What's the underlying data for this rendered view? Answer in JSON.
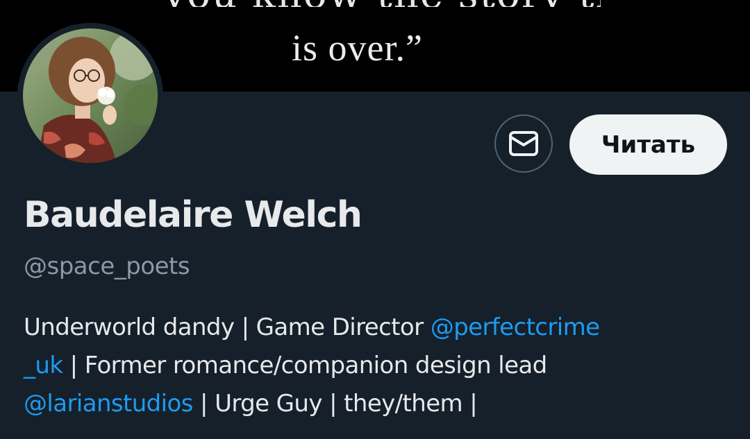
{
  "banner": {
    "quote_top": "“you know the story that",
    "quote_visible": "is over.”"
  },
  "profile": {
    "display_name": "Baudelaire Welch",
    "handle": "@space_poets",
    "follow_label": "Читать",
    "bio": {
      "line1_text": "Underworld dandy  | Game Director ",
      "line1_mention": "@perfectcrime",
      "line2_mention": "_uk",
      "line2_text": " | Former romance/companion design lead",
      "line3_mention": "@larianstudios",
      "line3_text": " | Urge Guy | they/them |"
    }
  },
  "icons": {
    "dm": "envelope-icon",
    "avatar": "profile-photo"
  },
  "colors": {
    "background": "#15202b",
    "link": "#1d9bf0",
    "muted": "#8b98a5",
    "button_bg": "#eff3f4"
  }
}
